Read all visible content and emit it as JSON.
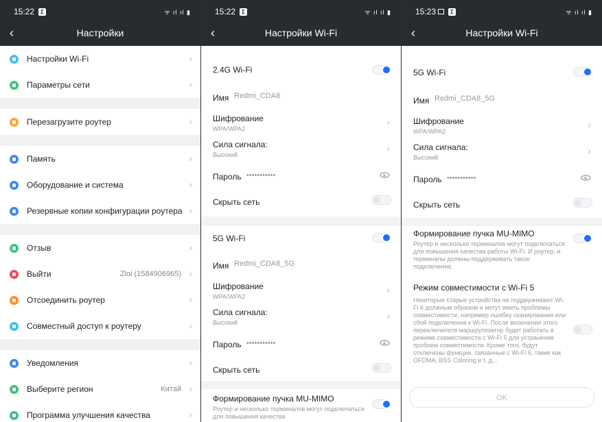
{
  "status": [
    {
      "time": "15:22",
      "badge": "Σ",
      "icons": "ᯤ ıl ıl ▮"
    },
    {
      "time": "15:22",
      "badge": "Σ",
      "icons": "ᯤ ıl ıl ▮"
    },
    {
      "time": "15:23",
      "badge": "Σ",
      "icons": "ᯤ ıl ıl ▮"
    }
  ],
  "settings": {
    "title": "Настройки",
    "groups": [
      [
        {
          "label": "Настройки Wi-Fi",
          "icon": "wifi-icon",
          "color": "#3ec3f2"
        },
        {
          "label": "Параметры сети",
          "icon": "network-icon",
          "color": "#3cc47a"
        }
      ],
      [
        {
          "label": "Перезагрузите роутер",
          "icon": "restart-icon",
          "color": "#ffa23a"
        }
      ],
      [
        {
          "label": "Память",
          "icon": "storage-icon",
          "color": "#3f87f5"
        },
        {
          "label": "Оборудование и система",
          "icon": "hardware-icon",
          "color": "#3f87f5"
        },
        {
          "label": "Резервные копии конфигурации роутера",
          "icon": "backup-icon",
          "color": "#3f87f5"
        }
      ],
      [
        {
          "label": "Отзыв",
          "icon": "feedback-icon",
          "color": "#3cc47a"
        },
        {
          "label": "Выйти",
          "icon": "logout-icon",
          "color": "#f0485f",
          "value": "Zloi (1584906965)"
        },
        {
          "label": "Отсоединить роутер",
          "icon": "unlink-icon",
          "color": "#ff8c2b"
        },
        {
          "label": "Совместный доступ к роутеру",
          "icon": "share-icon",
          "color": "#3ec3f2"
        }
      ],
      [
        {
          "label": "Уведомления",
          "icon": "bell-icon",
          "color": "#3f87f5"
        },
        {
          "label": "Выберите регион",
          "icon": "globe-icon",
          "color": "#3cc47a",
          "value": "Китай"
        },
        {
          "label": "Программа улучшения качества",
          "icon": "quality-icon",
          "color": "#3cc47a"
        }
      ]
    ]
  },
  "wifi24": {
    "title": "Настройки Wi-Fi",
    "band_label": "2.4G Wi-Fi",
    "name_label": "Имя",
    "name_value": "Redmi_CDA8",
    "enc_label": "Шифрование",
    "enc_value": "WPA/WPA2",
    "signal_label": "Сила сигнала:",
    "signal_value": "Высокий",
    "password_label": "Пароль",
    "password_value": "•••••••••••",
    "hide_label": "Скрыть сеть",
    "band5_label": "5G Wi-Fi",
    "name5_value": "Redmi_CDA8_5G",
    "mimo_label": "Формирование пучка MU-MIMO",
    "mimo_desc": "Роутер и несколько терминалов могут подключаться для повышения качества"
  },
  "wifi5": {
    "title": "Настройки Wi-Fi",
    "band_label": "5G Wi-Fi",
    "name_label": "Имя",
    "name_value": "Redmi_CDA8_5G",
    "enc_label": "Шифрование",
    "enc_value": "WPA/WPA2",
    "signal_label": "Сила сигнала:",
    "signal_value": "Высокий",
    "password_label": "Пароль",
    "password_value": "•••••••••••",
    "hide_label": "Скрыть сеть",
    "mimo_label": "Формирование пучка MU-MIMO",
    "mimo_desc": "Роутер и несколько терминалов могут подключаться для повышения качества работы Wi-Fi. И роутер, и терминалы должны поддерживать такое подключение.",
    "compat_label": "Режим совместимости с Wi-Fi 5",
    "compat_desc": "Некоторые старые устройства не поддерживают Wi-Fi 6 должным образом и могут иметь проблемы совместимости, например ошибку сканирования или сбой подключения к Wi-Fi. После включения этого переключателя маршрутизатор будет работать в режиме совместимости с Wi-Fi 5 для устранения проблем совместимости. Кроме того, будут отключены функции, связанные с Wi-Fi 6, такие как OFDMA, BSS Coloring и т. д...",
    "ok_label": "OK"
  }
}
